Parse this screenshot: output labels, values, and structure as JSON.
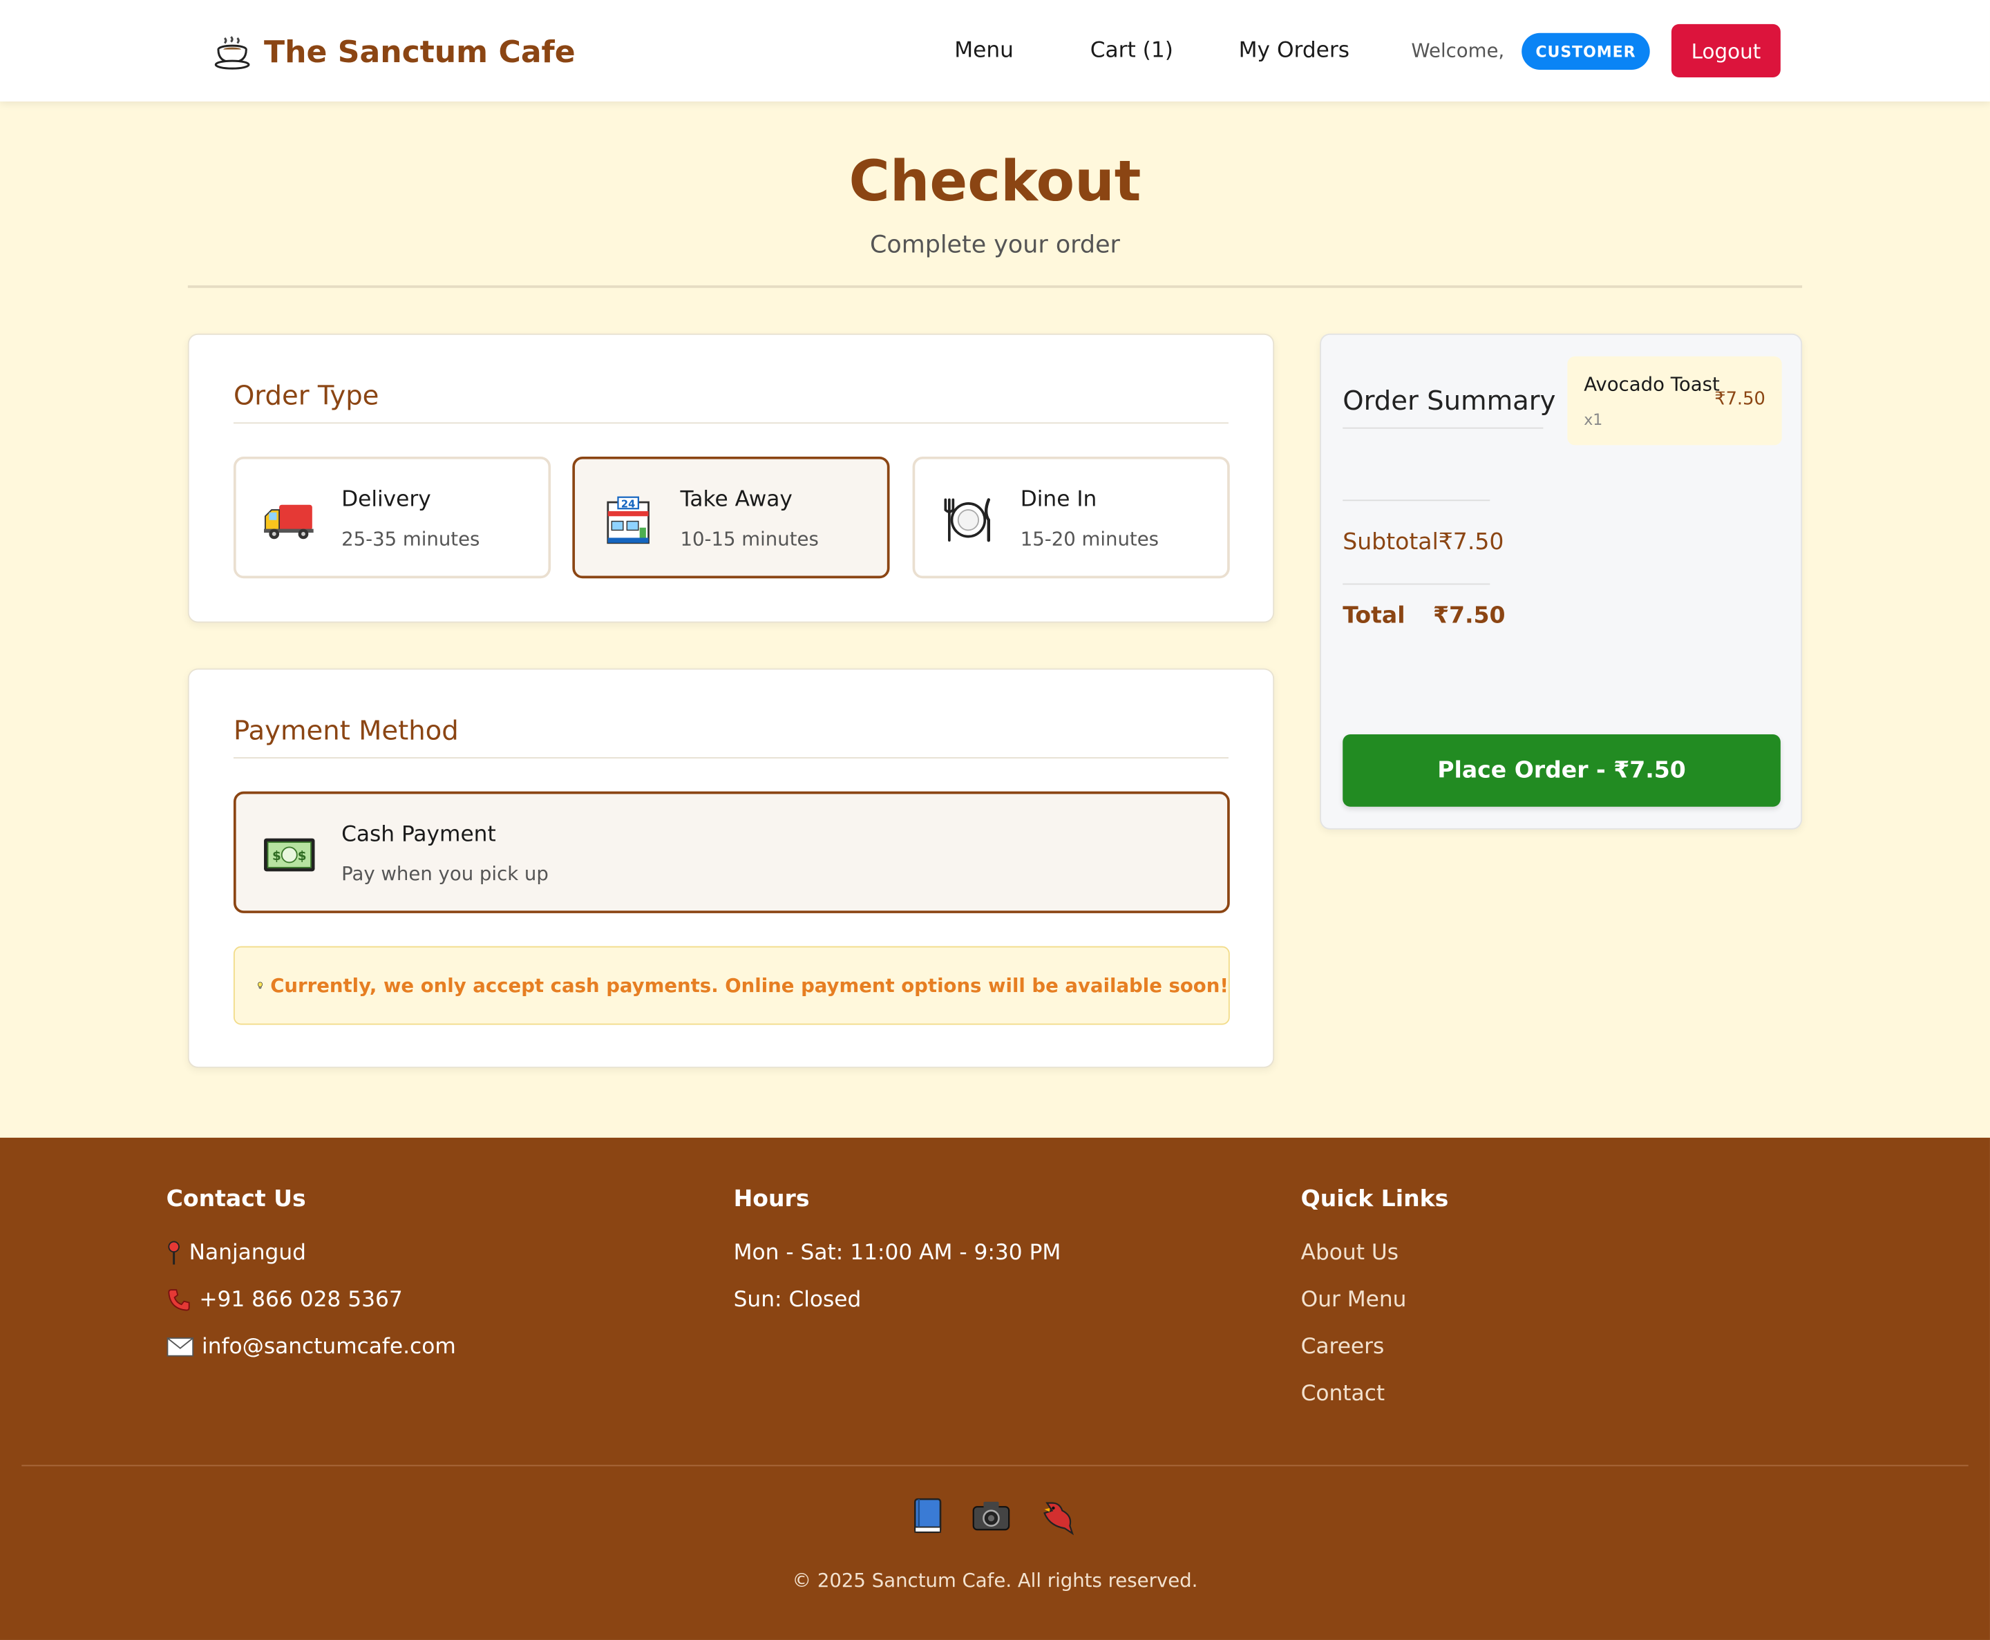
{
  "nav": {
    "brand": "The Sanctum Cafe",
    "brand_icon": "coffee-cup-icon",
    "links": [
      "Menu",
      "Cart (1)",
      "My Orders"
    ],
    "welcome": "Welcome,",
    "role": "CUSTOMER",
    "logout": "Logout"
  },
  "header": {
    "title": "Checkout",
    "subtitle": "Complete your order"
  },
  "order_type": {
    "title": "Order Type",
    "options": [
      {
        "label": "Delivery",
        "time": "25-35 minutes",
        "icon": "delivery-truck-icon",
        "selected": false
      },
      {
        "label": "Take Away",
        "time": "10-15 minutes",
        "icon": "store-24-icon",
        "selected": true
      },
      {
        "label": "Dine In",
        "time": "15-20 minutes",
        "icon": "plate-cutlery-icon",
        "selected": false
      }
    ]
  },
  "payment": {
    "title": "Payment Method",
    "option": {
      "label": "Cash Payment",
      "desc": "Pay when you pick up",
      "icon": "cash-icon",
      "selected": true
    },
    "notice_icon": "lightbulb-icon",
    "notice": "Currently, we only accept cash payments. Online payment options will be available soon!"
  },
  "summary": {
    "title": "Order Summary",
    "items": [
      {
        "name": "Avocado Toast",
        "price": "₹7.50",
        "qty": "x1"
      }
    ],
    "subtotal_label": "Subtotal",
    "subtotal_value": "₹7.50",
    "total_label": "Total",
    "total_value": "₹7.50",
    "button": "Place Order - ₹7.50"
  },
  "footer": {
    "contact": {
      "title": "Contact Us",
      "address": "Nanjangud",
      "phone": "+91 866 028 5367",
      "email": "info@sanctumcafe.com"
    },
    "hours": {
      "title": "Hours",
      "weekday": "Mon - Sat: 11:00 AM - 9:30 PM",
      "sunday": "Sun: Closed"
    },
    "links": {
      "title": "Quick Links",
      "items": [
        "About Us",
        "Our Menu",
        "Careers",
        "Contact"
      ]
    },
    "social_icons": [
      "book-icon",
      "camera-icon",
      "bird-icon"
    ],
    "copyright": "© 2025 Sanctum Cafe. All rights reserved."
  },
  "colors": {
    "brand": "#8b4513",
    "page_bg": "#fff8dc",
    "badge": "#0a84f5",
    "logout": "#dc143c",
    "place_order": "#228b22",
    "notice_text": "#e67e22"
  }
}
